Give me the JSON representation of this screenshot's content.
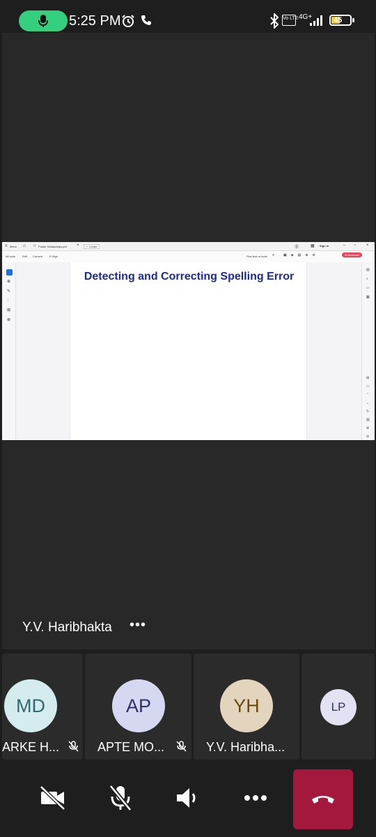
{
  "status_bar": {
    "time": "5:25 PM",
    "network": "4G+",
    "volte": "Vo LTE",
    "battery": "45",
    "icons": [
      "mic-icon",
      "alarm-icon",
      "phone-icon",
      "bluetooth-icon",
      "signal-icon",
      "battery-icon"
    ]
  },
  "shared_screen": {
    "tab_bar": {
      "menu_label": "Menu",
      "tab_label": "Poster Sahasrariya.pdf",
      "new_tab_label": "+ Create",
      "sign_in_label": "Sign in"
    },
    "toolbar": {
      "items": [
        "All tools",
        "Edit",
        "Convert",
        "E-Sign"
      ],
      "find_placeholder": "Find text or tools",
      "ai_assistant_label": "AI Assistant"
    },
    "document_title": "Detecting and Correcting Spelling Error"
  },
  "active_speaker": {
    "name": "Y.V. Haribhakta",
    "more_label": "•••"
  },
  "participants": [
    {
      "initials": "MD",
      "label": "ARKE H...",
      "muted": true,
      "avatar_color": "#d5ecee",
      "text_color": "#2e6a70"
    },
    {
      "initials": "AP",
      "label": "APTE MO...",
      "muted": true,
      "avatar_color": "#d6d7f0",
      "text_color": "#2a3070"
    },
    {
      "initials": "YH",
      "label": "Y.V. Haribha...",
      "muted": false,
      "avatar_color": "#e3d5bd",
      "text_color": "#6a4a12"
    },
    {
      "initials": "LP",
      "label": "",
      "muted": false,
      "avatar_color": "#e3e2f2",
      "text_color": "#2f2f6a"
    }
  ],
  "controls": {
    "icons": [
      "video-off-icon",
      "mic-off-icon",
      "speaker-icon",
      "more-icon",
      "hang-up-icon"
    ],
    "hangup_color": "#a3183c"
  }
}
